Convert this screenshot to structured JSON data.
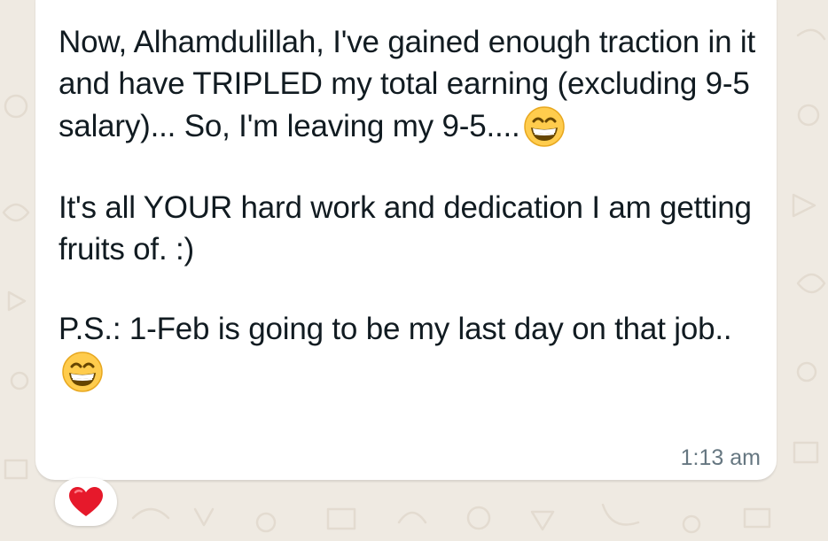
{
  "wallpaper_color": "#efeae2",
  "message": {
    "paragraphs": [
      {
        "text": "Now, Alhamdulillah, I've gained enough traction in it and have TRIPLED my total earning (excluding 9-5 salary)... So, I'm leaving my 9-5....",
        "emoji": "grinning-face-with-smiling-eyes"
      },
      {
        "text": "It's all YOUR hard work and dedication I am getting fruits of. :)",
        "emoji": ""
      },
      {
        "text": "P.S.: 1-Feb is going to be my last day on that job..",
        "emoji": "grinning-face-with-smiling-eyes"
      }
    ],
    "timestamp": "1:13 am"
  },
  "reaction": {
    "emoji": "red-heart"
  }
}
